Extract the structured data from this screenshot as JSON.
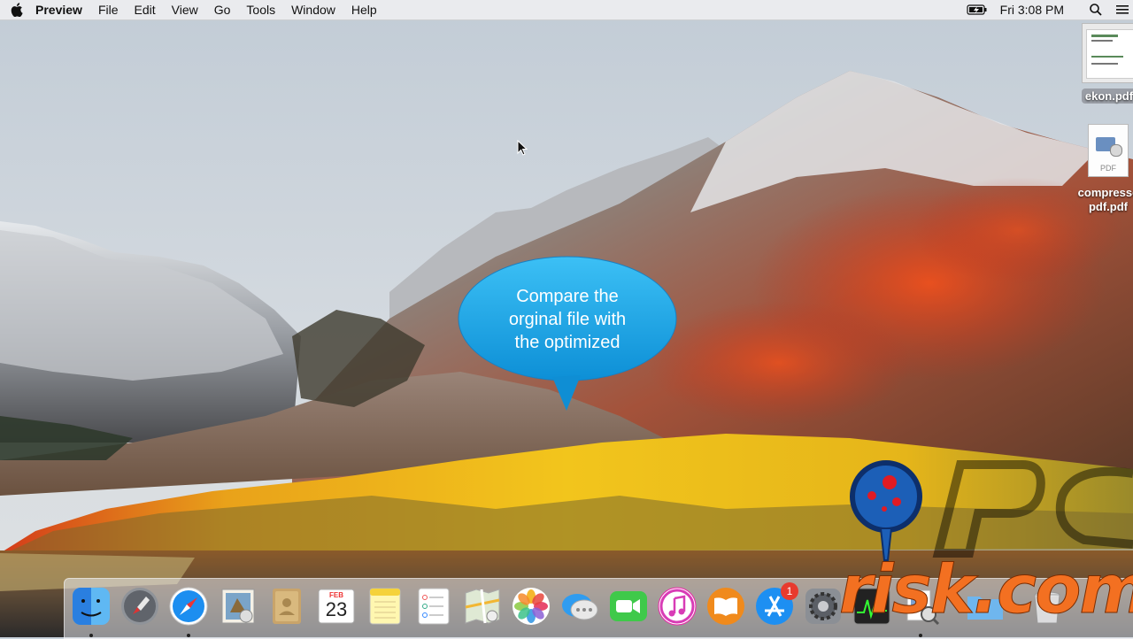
{
  "menubar": {
    "apple_icon": "apple-logo-icon",
    "app_name": "Preview",
    "menus": [
      "File",
      "Edit",
      "View",
      "Go",
      "Tools",
      "Window",
      "Help"
    ],
    "status_icons": [
      "battery-charging-icon",
      "spotlight-search-icon",
      "list-icon"
    ],
    "clock": "Fri 3:08 PM"
  },
  "desktop": {
    "files": [
      {
        "label": "ekon.pdf",
        "icon": "pdf-thumbnail-icon"
      },
      {
        "label": "compressed-pdf.pdf",
        "label_line1": "compresse",
        "label_line2": "pdf.pdf",
        "icon": "pdf-file-icon",
        "badge": "PDF"
      }
    ]
  },
  "callout": {
    "lines": [
      "Compare the",
      "orginal file with",
      "the optimized"
    ],
    "color": "#1ea4e6"
  },
  "dock": {
    "items": [
      {
        "name": "finder",
        "running": true
      },
      {
        "name": "launchpad",
        "running": false
      },
      {
        "name": "safari",
        "running": true
      },
      {
        "name": "mail",
        "running": false
      },
      {
        "name": "contacts",
        "running": false
      },
      {
        "name": "calendar",
        "running": false,
        "month": "FEB",
        "day": "23"
      },
      {
        "name": "notes",
        "running": false
      },
      {
        "name": "reminders",
        "running": false
      },
      {
        "name": "maps",
        "running": false
      },
      {
        "name": "photos",
        "running": false
      },
      {
        "name": "messages",
        "running": false
      },
      {
        "name": "facetime",
        "running": false
      },
      {
        "name": "itunes",
        "running": false
      },
      {
        "name": "ibooks",
        "running": false
      },
      {
        "name": "app-store",
        "running": false,
        "badge": "1"
      },
      {
        "name": "system-preferences",
        "running": false
      },
      {
        "name": "activity-monitor",
        "running": false
      },
      {
        "name": "preview",
        "running": true
      },
      {
        "name": "downloads-folder",
        "running": false
      },
      {
        "name": "trash",
        "running": false
      }
    ]
  },
  "watermark": {
    "text_top": "PC",
    "text_bottom": "risk.com",
    "colors": {
      "orange": "#f37021",
      "blue": "#1c5fb7",
      "red": "#e01b24"
    }
  }
}
